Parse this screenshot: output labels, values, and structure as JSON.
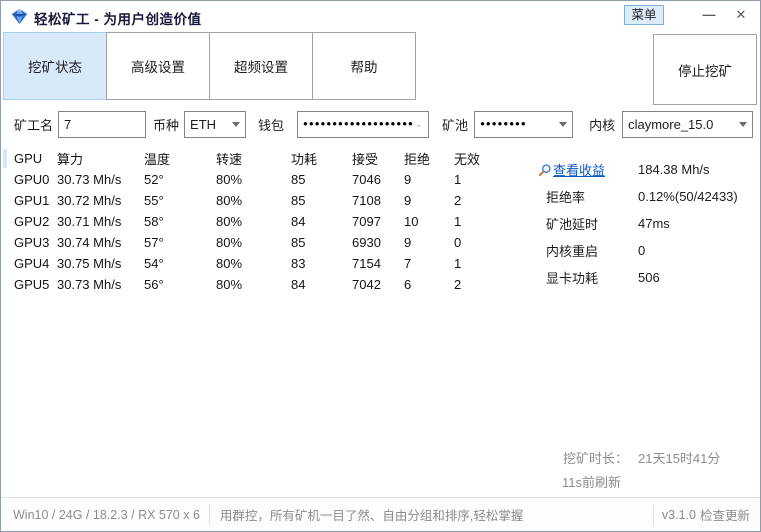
{
  "window": {
    "title": "轻松矿工 - 为用户创造价值"
  },
  "titlebar": {
    "menu_label": "菜单",
    "minimize_glyph": "—",
    "close_glyph": "✕"
  },
  "tabs": [
    {
      "label": "挖矿状态",
      "active": true
    },
    {
      "label": "高级设置",
      "active": false
    },
    {
      "label": "超频设置",
      "active": false
    },
    {
      "label": "帮助",
      "active": false
    }
  ],
  "stop_button_label": "停止挖矿",
  "form": {
    "miner_name": {
      "label": "矿工名",
      "value": "7"
    },
    "coin": {
      "label": "币种",
      "value": "ETH"
    },
    "wallet": {
      "label": "钱包",
      "value": "●●●●●●●●●●●●●●●●●●●"
    },
    "pool": {
      "label": "矿池",
      "value": "●●●●●●●●"
    },
    "kernel": {
      "label": "内核",
      "value": "claymore_15.0"
    }
  },
  "table": {
    "headers": [
      "GPU",
      "算力",
      "温度",
      "转速",
      "功耗",
      "接受",
      "拒绝",
      "无效"
    ],
    "rows": [
      [
        "GPU0",
        "30.73 Mh/s",
        "52°",
        "80%",
        "85",
        "7046",
        "9",
        "1"
      ],
      [
        "GPU1",
        "30.72 Mh/s",
        "55°",
        "80%",
        "85",
        "7108",
        "9",
        "2"
      ],
      [
        "GPU2",
        "30.71 Mh/s",
        "58°",
        "80%",
        "84",
        "7097",
        "10",
        "1"
      ],
      [
        "GPU3",
        "30.74 Mh/s",
        "57°",
        "80%",
        "85",
        "6930",
        "9",
        "0"
      ],
      [
        "GPU4",
        "30.75 Mh/s",
        "54°",
        "80%",
        "83",
        "7154",
        "7",
        "1"
      ],
      [
        "GPU5",
        "30.73 Mh/s",
        "56°",
        "80%",
        "84",
        "7042",
        "6",
        "2"
      ]
    ]
  },
  "stats": {
    "earnings_link": "查看收益",
    "total_hashrate": "184.38 Mh/s",
    "rows": [
      {
        "label": "拒绝率",
        "value": "0.12%(50/42433)"
      },
      {
        "label": "矿池延时",
        "value": "47ms"
      },
      {
        "label": "内核重启",
        "value": "0"
      },
      {
        "label": "显卡功耗",
        "value": "506"
      }
    ],
    "duration_label": "挖矿时长：",
    "duration_value": "21天15时41分",
    "refresh_note": "11s前刷新"
  },
  "statusbar": {
    "system_info": "Win10  / 24G / 18.2.3 / RX 570 x 6",
    "promo": "用群控，所有矿机一目了然、自由分组和排序,轻松掌握",
    "version": "v3.1.0",
    "update_link": "检查更新"
  },
  "icons": {
    "app_icon": "blue-diamond",
    "earnings_icon": "magnifier",
    "dropdown_icon": "caret-down",
    "wallet_combo_icon": "chevron-down"
  },
  "colors": {
    "active_tab_bg": "#d8eafa",
    "active_tab_border": "#a9cdec",
    "menu_btn_bg": "#dcecfb",
    "menu_btn_border": "#7caedd",
    "link_blue": "#0a58c0",
    "muted_gray": "#8d8d8d",
    "window_border": "#8f9bab"
  }
}
